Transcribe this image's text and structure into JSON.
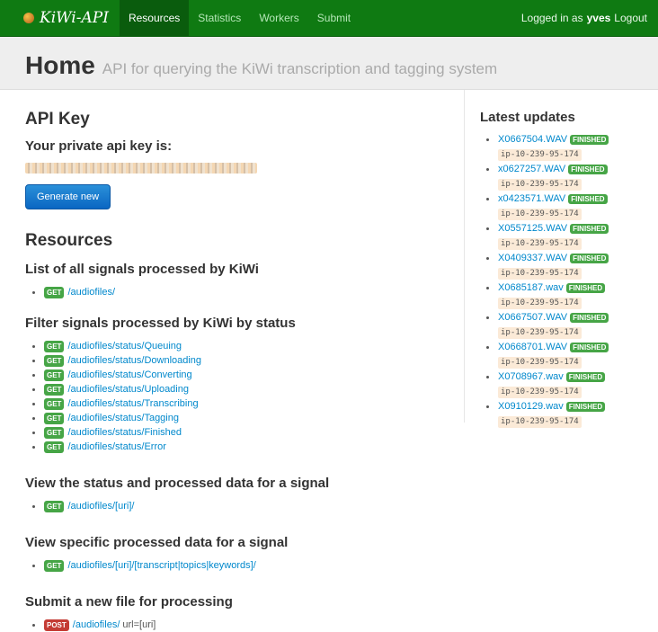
{
  "brand": {
    "name": "KiWi-API"
  },
  "nav": {
    "tabs": [
      {
        "label": "Resources",
        "active": true
      },
      {
        "label": "Statistics",
        "active": false
      },
      {
        "label": "Workers",
        "active": false
      },
      {
        "label": "Submit",
        "active": false
      }
    ],
    "logged_in_prefix": "Logged in as",
    "user": "yves",
    "logout": "Logout"
  },
  "header": {
    "title": "Home",
    "subtitle": "API for querying the KiWi transcription and tagging system"
  },
  "api_key": {
    "heading": "API Key",
    "label": "Your private api key is:",
    "button": "Generate new"
  },
  "resources": {
    "heading": "Resources",
    "sections": [
      {
        "title": "List of all signals processed by KiWi",
        "endpoints": [
          {
            "method": "GET",
            "path": "/audiofiles/",
            "param": ""
          }
        ]
      },
      {
        "title": "Filter signals processed by KiWi by status",
        "endpoints": [
          {
            "method": "GET",
            "path": "/audiofiles/status/Queuing",
            "param": ""
          },
          {
            "method": "GET",
            "path": "/audiofiles/status/Downloading",
            "param": ""
          },
          {
            "method": "GET",
            "path": "/audiofiles/status/Converting",
            "param": ""
          },
          {
            "method": "GET",
            "path": "/audiofiles/status/Uploading",
            "param": ""
          },
          {
            "method": "GET",
            "path": "/audiofiles/status/Transcribing",
            "param": ""
          },
          {
            "method": "GET",
            "path": "/audiofiles/status/Tagging",
            "param": ""
          },
          {
            "method": "GET",
            "path": "/audiofiles/status/Finished",
            "param": ""
          },
          {
            "method": "GET",
            "path": "/audiofiles/status/Error",
            "param": ""
          }
        ]
      },
      {
        "title": "View the status and processed data for a signal",
        "endpoints": [
          {
            "method": "GET",
            "path": "/audiofiles/[uri]/",
            "param": ""
          }
        ]
      },
      {
        "title": "View specific processed data for a signal",
        "endpoints": [
          {
            "method": "GET",
            "path": "/audiofiles/[uri]/[transcript|topics|keywords]/",
            "param": ""
          }
        ]
      },
      {
        "title": "Submit a new file for processing",
        "endpoints": [
          {
            "method": "POST",
            "path": "/audiofiles/",
            "param": "url=[uri]"
          }
        ]
      }
    ]
  },
  "updates": {
    "heading": "Latest updates",
    "items": [
      {
        "file": "X0667504.WAV",
        "status": "FINISHED",
        "host": "ip-10-239-95-174"
      },
      {
        "file": "x0627257.WAV",
        "status": "FINISHED",
        "host": "ip-10-239-95-174"
      },
      {
        "file": "x0423571.WAV",
        "status": "FINISHED",
        "host": "ip-10-239-95-174"
      },
      {
        "file": "X0557125.WAV",
        "status": "FINISHED",
        "host": "ip-10-239-95-174"
      },
      {
        "file": "X0409337.WAV",
        "status": "FINISHED",
        "host": "ip-10-239-95-174"
      },
      {
        "file": "X0685187.wav",
        "status": "FINISHED",
        "host": "ip-10-239-95-174"
      },
      {
        "file": "X0667507.WAV",
        "status": "FINISHED",
        "host": "ip-10-239-95-174"
      },
      {
        "file": "X0668701.WAV",
        "status": "FINISHED",
        "host": "ip-10-239-95-174"
      },
      {
        "file": "X0708967.wav",
        "status": "FINISHED",
        "host": "ip-10-239-95-174"
      },
      {
        "file": "X0910129.wav",
        "status": "FINISHED",
        "host": "ip-10-239-95-174"
      }
    ]
  }
}
